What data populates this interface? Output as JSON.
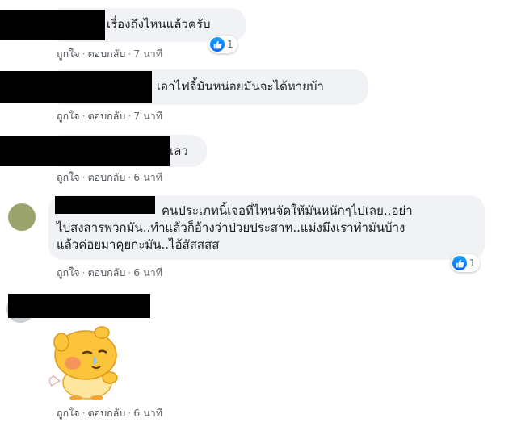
{
  "comments": [
    {
      "text": "เรื่องถึงไหนแล้วครับ",
      "like": "ถูกใจ",
      "reply": "ตอบกลับ",
      "time": "7 นาที",
      "reactions": "1"
    },
    {
      "text": "เอาไฟจี้มันหน่อยมันจะได้หายบ้า",
      "like": "ถูกใจ",
      "reply": "ตอบกลับ",
      "time": "7 นาที"
    },
    {
      "text": "เลว",
      "like": "ถูกใจ",
      "reply": "ตอบกลับ",
      "time": "6 นาที"
    },
    {
      "lines": [
        "คนประเภทนี้เจอที่ไหนจัดให้มันหนักๆไปเลย..อย่า",
        "ไปสงสารพวกมัน..ทำแล้วก็อ้างว่าป่วยประสาท..แม่งมึงเราทำมันบ้าง",
        "แล้วค่อยมาคุยกะมัน..ไอ้สัสสสส"
      ],
      "like": "ถูกใจ",
      "reply": "ตอบกลับ",
      "time": "6 นาที",
      "reactions": "1"
    },
    {
      "sticker": "crying-chick-sticker",
      "like": "ถูกใจ",
      "reply": "ตอบกลับ",
      "time": "6 นาที"
    }
  ],
  "icons": {
    "reaction": "like-thumb-icon"
  },
  "colors": {
    "bubble": "#f0f2f5",
    "link": "#4b4f56",
    "meta": "#65676b",
    "like": "#1877f2",
    "redaction": "#000000"
  }
}
